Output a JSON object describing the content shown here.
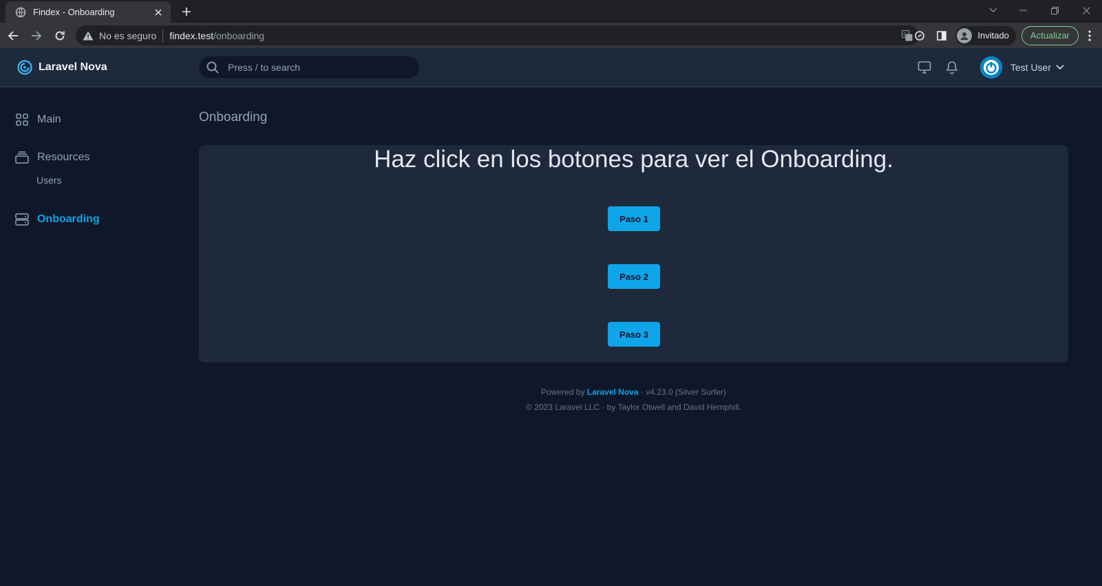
{
  "browser": {
    "tab_title": "Findex - Onboarding",
    "insecure_label": "No es seguro",
    "url_host": "findex.test",
    "url_path": "/onboarding",
    "profile_name": "Invitado",
    "update_label": "Actualizar"
  },
  "header": {
    "brand": "Laravel Nova",
    "search_placeholder": "Press / to search",
    "user_name": "Test User"
  },
  "sidebar": {
    "items": [
      {
        "label": "Main",
        "icon": "grid-icon"
      },
      {
        "label": "Resources",
        "icon": "stack-icon"
      },
      {
        "label": "Users"
      },
      {
        "label": "Onboarding",
        "icon": "server-icon",
        "active": true
      }
    ]
  },
  "main": {
    "page_title": "Onboarding",
    "headline": "Haz click en los botones para ver el Onboarding.",
    "buttons": [
      "Paso 1",
      "Paso 2",
      "Paso 3"
    ]
  },
  "footer": {
    "powered_by": "Powered by",
    "nova_link": "Laravel Nova",
    "version": "· v4.23.0 (Silver Surfer)",
    "copyright": "© 2023 Laravel LLC · by Taylor Otwell and David Hemphill."
  },
  "colors": {
    "accent": "#0ea5e9",
    "background": "#0f172a",
    "panel": "#1e293b"
  }
}
